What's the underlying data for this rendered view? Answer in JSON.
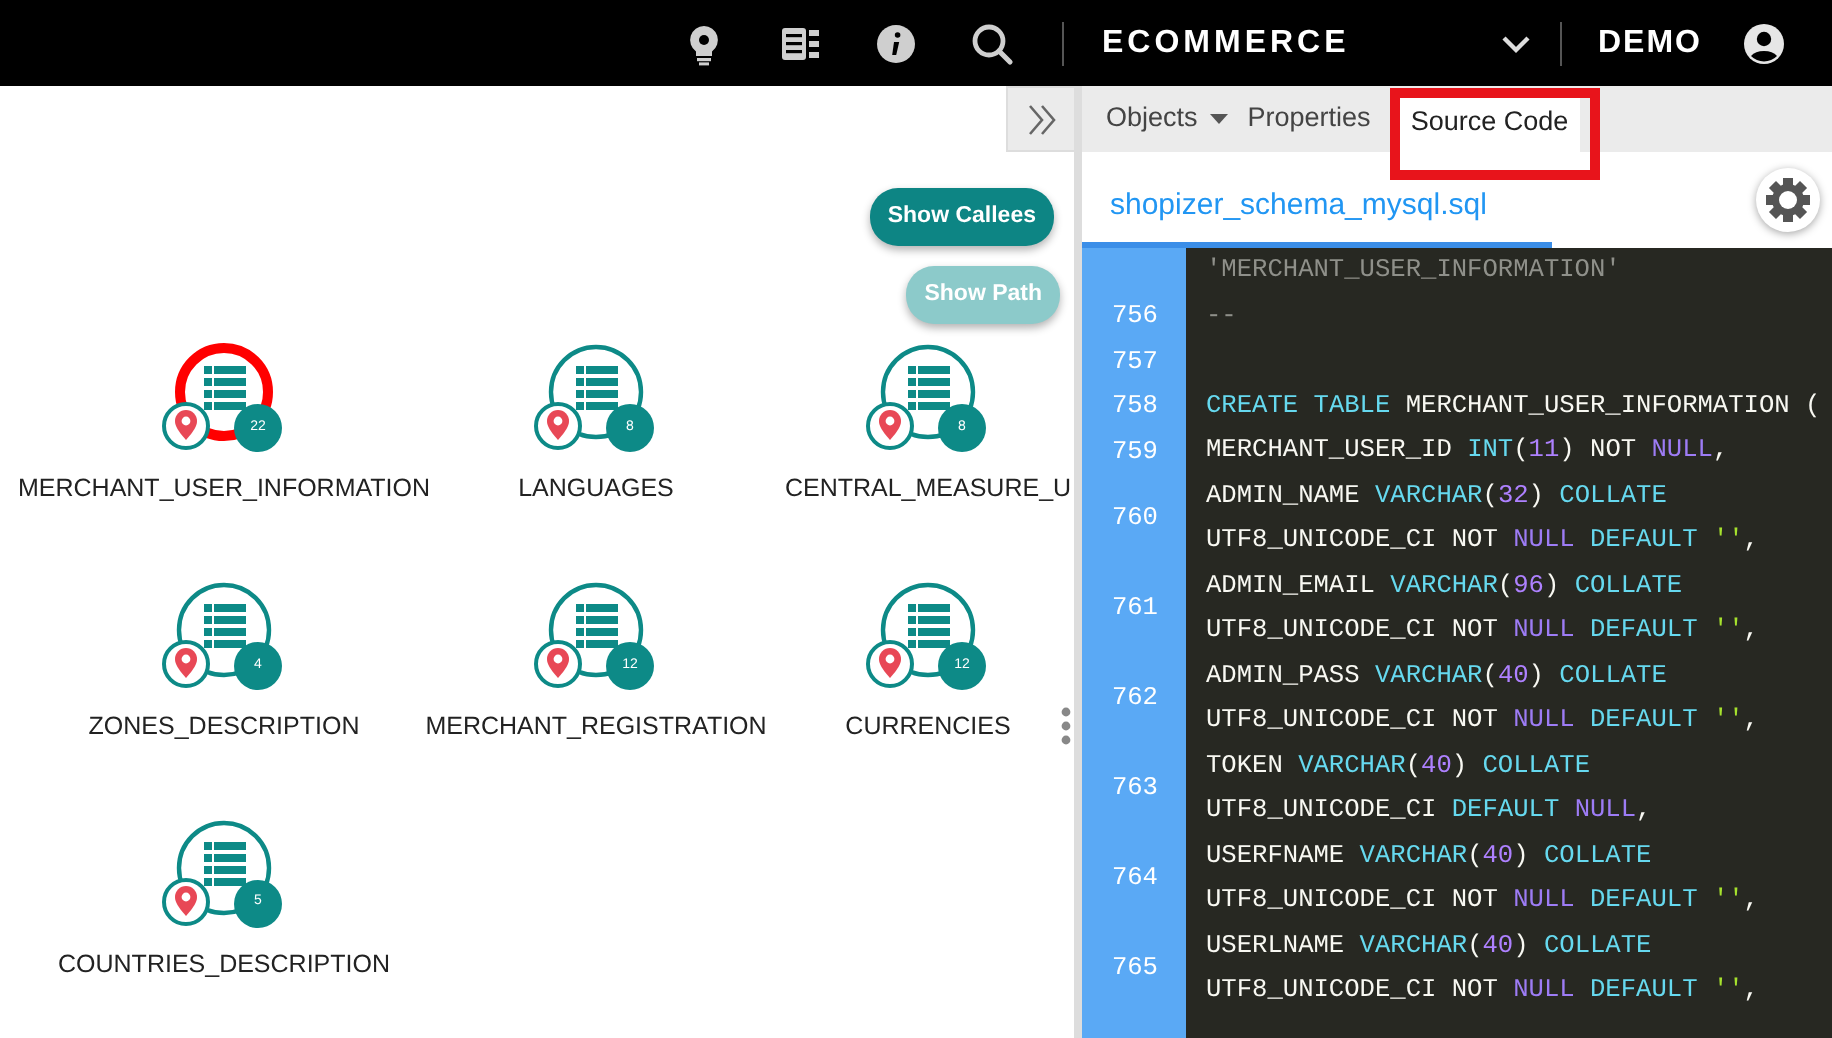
{
  "navbar": {
    "app": "ECOMMERCE",
    "user": "DEMO"
  },
  "canvas": {
    "buttons": [
      {
        "label": "Show Callees",
        "disabled": false
      },
      {
        "label": "Show Path",
        "disabled": true
      }
    ],
    "nodes": [
      {
        "label": "MERCHANT_USER_INFORMATION",
        "count": "22",
        "selected": true
      },
      {
        "label": "LANGUAGES",
        "count": "8",
        "selected": false
      },
      {
        "label": "CENTRAL_MEASURE_U",
        "count": "8",
        "selected": false
      },
      {
        "label": "ZONES_DESCRIPTION",
        "count": "4",
        "selected": false
      },
      {
        "label": "MERCHANT_REGISTRATION",
        "count": "12",
        "selected": false
      },
      {
        "label": "CURRENCIES",
        "count": "12",
        "selected": false
      },
      {
        "label": "COUNTRIES_DESCRIPTION",
        "count": "5",
        "selected": false
      }
    ]
  },
  "panel": {
    "tabs": [
      {
        "label": "Objects",
        "has_menu": true,
        "selected": false,
        "highlighted": false
      },
      {
        "label": "Properties",
        "has_menu": false,
        "selected": false,
        "highlighted": false
      },
      {
        "label": "Source Code",
        "has_menu": false,
        "selected": true,
        "highlighted": true
      }
    ],
    "file": {
      "name": "shopizer_schema_mysql.sql",
      "selected": true
    },
    "code": [
      {
        "lines": [
          [
            {
              "kind": "comment",
              "text": "'MERCHANT_USER_INFORMATION'"
            }
          ]
        ]
      },
      {
        "number": "756",
        "lines": [
          [
            {
              "kind": "comment",
              "text": "--"
            }
          ]
        ]
      },
      {
        "number": "757"
      },
      {
        "number": "758",
        "lines": [
          [
            {
              "kind": "kw",
              "text": "CREATE "
            },
            {
              "kind": "kw",
              "text": "TABLE "
            },
            {
              "kind": "text",
              "text": "MERCHANT_USER_INFORMATION ("
            }
          ]
        ]
      },
      {
        "number": "759",
        "lines": [
          [
            {
              "kind": "text",
              "text": "MERCHANT_USER_ID "
            },
            {
              "kind": "kw",
              "text": "INT"
            },
            {
              "kind": "text",
              "text": "("
            },
            {
              "kind": "num",
              "text": "11"
            },
            {
              "kind": "text",
              "text": ") NOT "
            },
            {
              "kind": "null",
              "text": "NULL"
            },
            {
              "kind": "text",
              "text": ","
            }
          ]
        ]
      },
      {
        "number": "760",
        "lines": [
          [
            {
              "kind": "text",
              "text": "ADMIN_NAME "
            },
            {
              "kind": "kw",
              "text": "VARCHAR"
            },
            {
              "kind": "text",
              "text": "("
            },
            {
              "kind": "num",
              "text": "32"
            },
            {
              "kind": "text",
              "text": ") "
            },
            {
              "kind": "kw",
              "text": "COLLATE"
            }
          ],
          [
            {
              "kind": "text",
              "text": "UTF8_UNICODE_CI NOT "
            },
            {
              "kind": "null",
              "text": "NULL "
            },
            {
              "kind": "kw",
              "text": "DEFAULT "
            },
            {
              "kind": "str",
              "text": "''"
            },
            {
              "kind": "text",
              "text": ","
            }
          ]
        ]
      },
      {
        "number": "761",
        "lines": [
          [
            {
              "kind": "text",
              "text": "ADMIN_EMAIL "
            },
            {
              "kind": "kw",
              "text": "VARCHAR"
            },
            {
              "kind": "text",
              "text": "("
            },
            {
              "kind": "num",
              "text": "96"
            },
            {
              "kind": "text",
              "text": ") "
            },
            {
              "kind": "kw",
              "text": "COLLATE"
            }
          ],
          [
            {
              "kind": "text",
              "text": "UTF8_UNICODE_CI NOT "
            },
            {
              "kind": "null",
              "text": "NULL "
            },
            {
              "kind": "kw",
              "text": "DEFAULT "
            },
            {
              "kind": "str",
              "text": "''"
            },
            {
              "kind": "text",
              "text": ","
            }
          ]
        ]
      },
      {
        "number": "762",
        "lines": [
          [
            {
              "kind": "text",
              "text": "ADMIN_PASS "
            },
            {
              "kind": "kw",
              "text": "VARCHAR"
            },
            {
              "kind": "text",
              "text": "("
            },
            {
              "kind": "num",
              "text": "40"
            },
            {
              "kind": "text",
              "text": ") "
            },
            {
              "kind": "kw",
              "text": "COLLATE"
            }
          ],
          [
            {
              "kind": "text",
              "text": "UTF8_UNICODE_CI NOT "
            },
            {
              "kind": "null",
              "text": "NULL "
            },
            {
              "kind": "kw",
              "text": "DEFAULT "
            },
            {
              "kind": "str",
              "text": "''"
            },
            {
              "kind": "text",
              "text": ","
            }
          ]
        ]
      },
      {
        "number": "763",
        "lines": [
          [
            {
              "kind": "text",
              "text": "TOKEN "
            },
            {
              "kind": "kw",
              "text": "VARCHAR"
            },
            {
              "kind": "text",
              "text": "("
            },
            {
              "kind": "num",
              "text": "40"
            },
            {
              "kind": "text",
              "text": ") "
            },
            {
              "kind": "kw",
              "text": "COLLATE"
            }
          ],
          [
            {
              "kind": "text",
              "text": "UTF8_UNICODE_CI "
            },
            {
              "kind": "kw",
              "text": "DEFAULT "
            },
            {
              "kind": "null",
              "text": "NULL"
            },
            {
              "kind": "text",
              "text": ","
            }
          ]
        ]
      },
      {
        "number": "764",
        "lines": [
          [
            {
              "kind": "text",
              "text": "USERFNAME "
            },
            {
              "kind": "kw",
              "text": "VARCHAR"
            },
            {
              "kind": "text",
              "text": "("
            },
            {
              "kind": "num",
              "text": "40"
            },
            {
              "kind": "text",
              "text": ") "
            },
            {
              "kind": "kw",
              "text": "COLLATE"
            }
          ],
          [
            {
              "kind": "text",
              "text": "UTF8_UNICODE_CI NOT "
            },
            {
              "kind": "null",
              "text": "NULL "
            },
            {
              "kind": "kw",
              "text": "DEFAULT "
            },
            {
              "kind": "str",
              "text": "''"
            },
            {
              "kind": "text",
              "text": ","
            }
          ]
        ]
      },
      {
        "number": "765",
        "lines": [
          [
            {
              "kind": "text",
              "text": "USERLNAME "
            },
            {
              "kind": "kw",
              "text": "VARCHAR"
            },
            {
              "kind": "text",
              "text": "("
            },
            {
              "kind": "num",
              "text": "40"
            },
            {
              "kind": "text",
              "text": ") "
            },
            {
              "kind": "kw",
              "text": "COLLATE"
            }
          ],
          [
            {
              "kind": "text",
              "text": "UTF8_UNICODE_CI NOT "
            },
            {
              "kind": "null",
              "text": "NULL "
            },
            {
              "kind": "kw",
              "text": "DEFAULT "
            },
            {
              "kind": "str",
              "text": "''"
            },
            {
              "kind": "text",
              "text": ","
            }
          ]
        ]
      }
    ]
  }
}
